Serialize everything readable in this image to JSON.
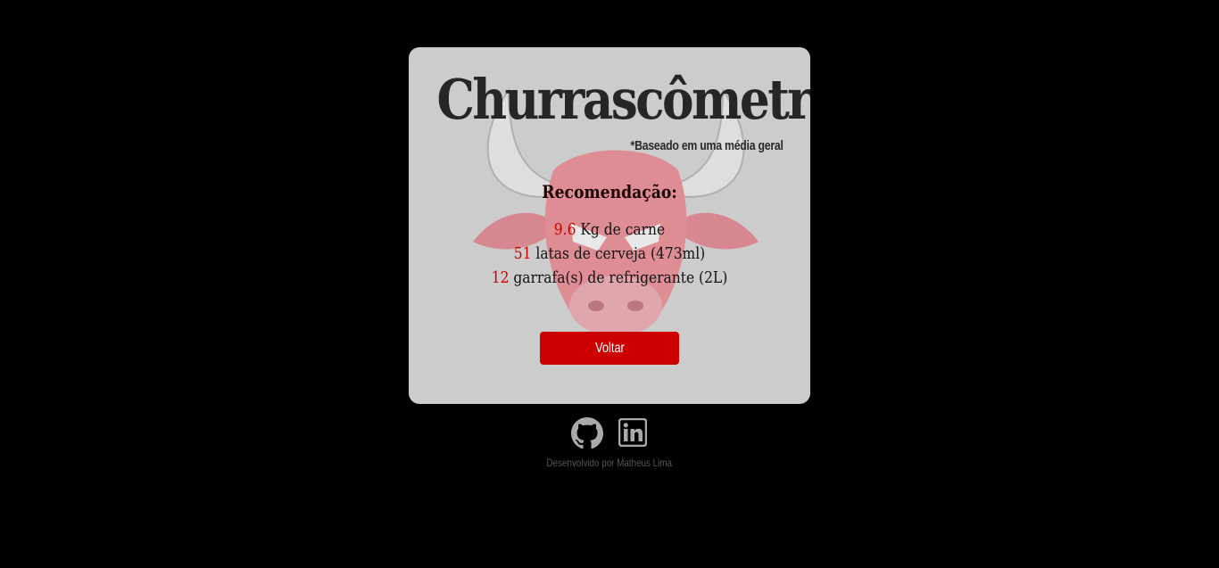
{
  "card": {
    "title": "Churrascômetro",
    "subtitle": "*Baseado em uma média geral",
    "recommendation_heading": "Recomendação:",
    "results": [
      {
        "value": "9.6",
        "label": " Kg de carne"
      },
      {
        "value": "51",
        "label": " latas de cerveja (473ml)"
      },
      {
        "value": "12",
        "label": " garrafa(s) de refrigerante (2L)"
      }
    ],
    "back_button": "Voltar",
    "background_image_icon": "bull-icon"
  },
  "footer": {
    "icons": [
      "github-icon",
      "linkedin-icon"
    ],
    "credit": "Desenvolvido por Matheus Lima"
  },
  "colors": {
    "background": "#000000",
    "card": "#cccccc",
    "accent": "#cc0000",
    "icon": "#aaaaaa"
  }
}
